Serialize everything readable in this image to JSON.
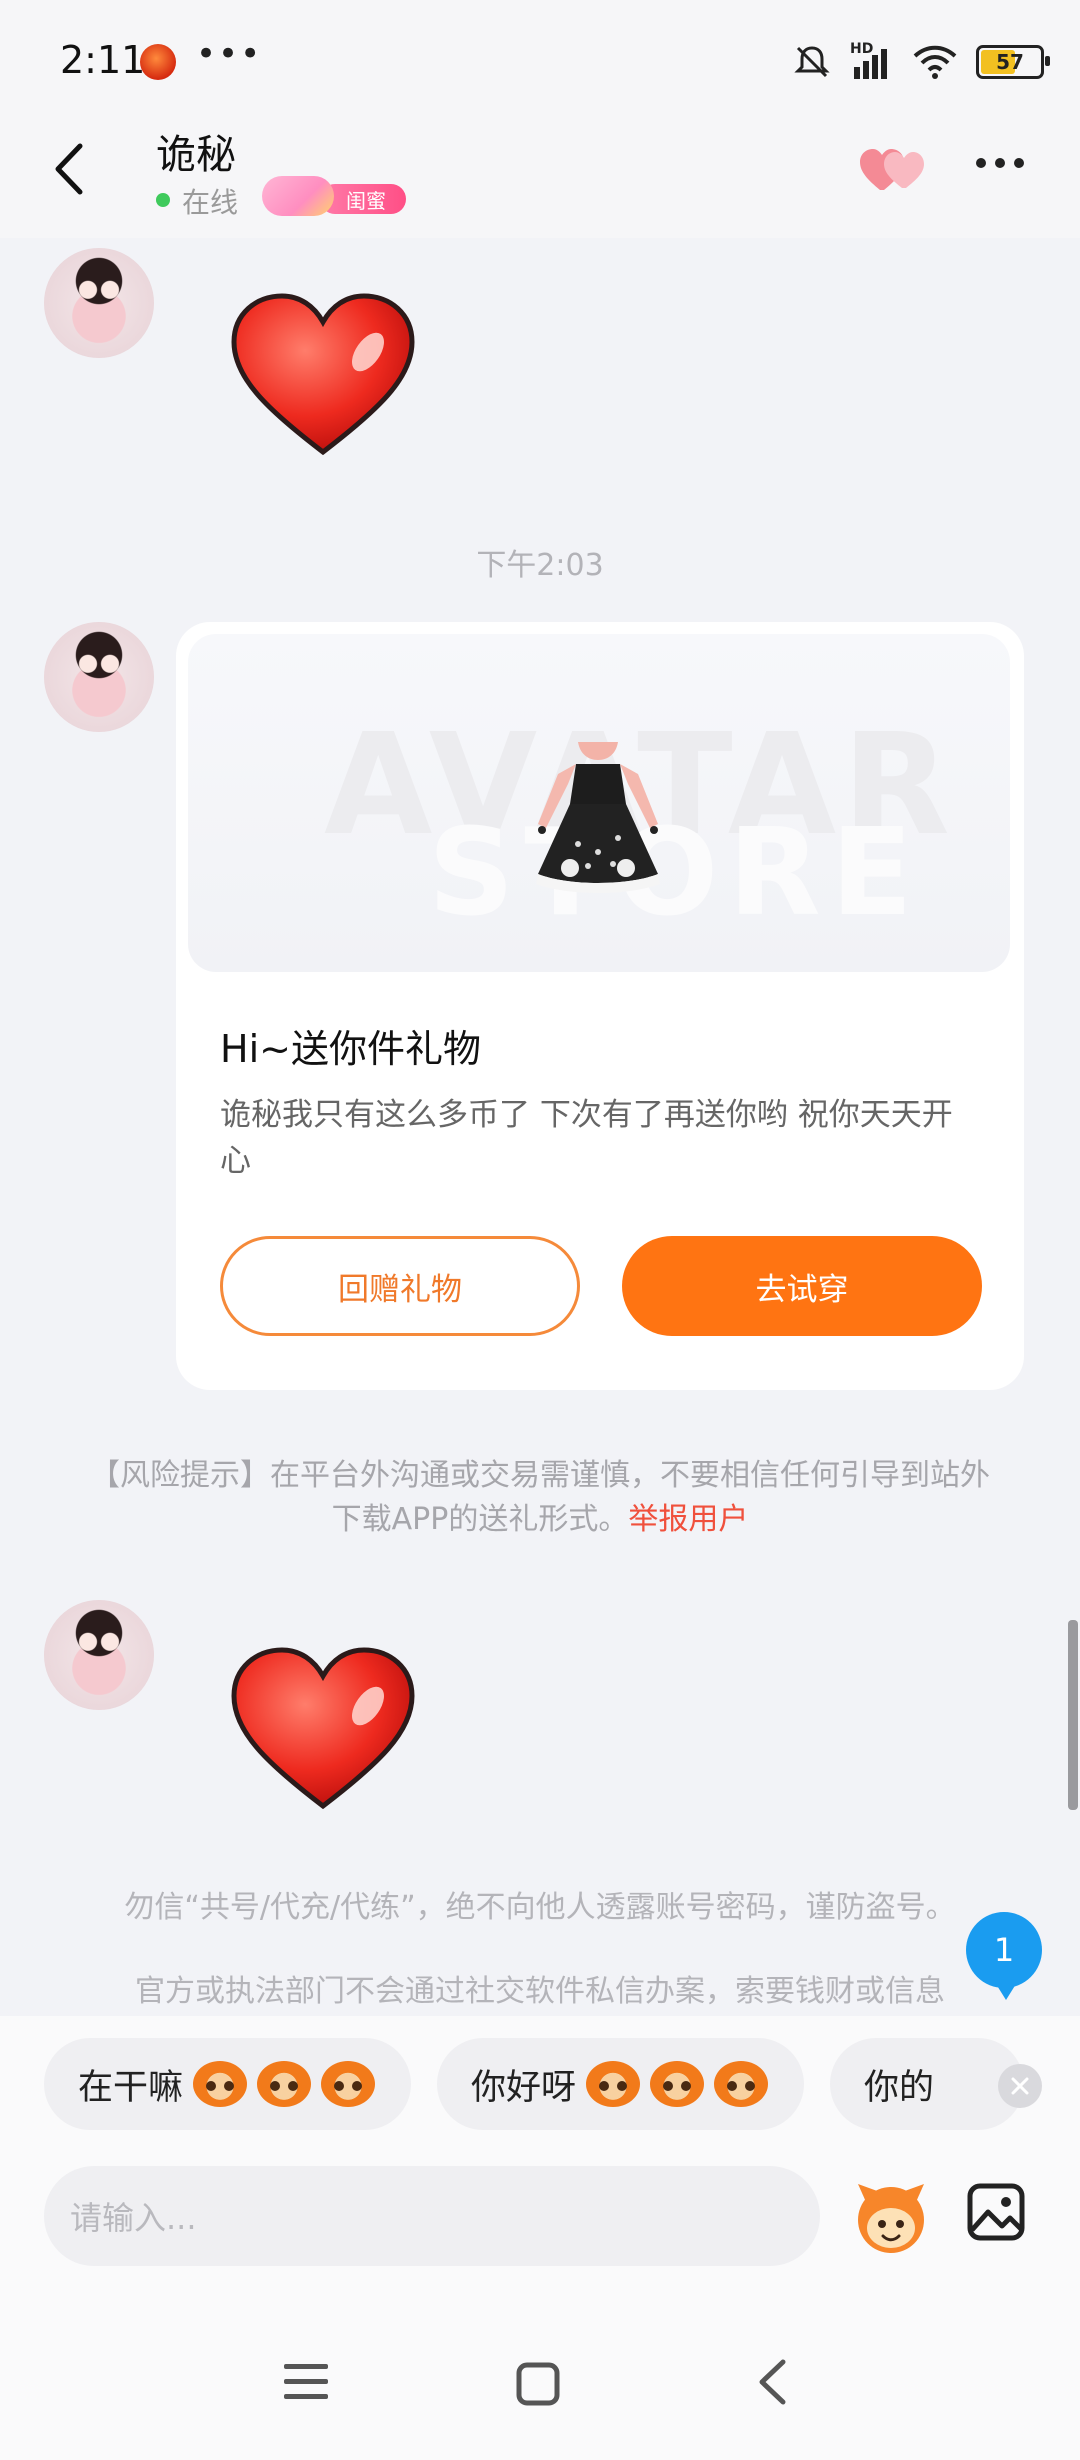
{
  "status_bar": {
    "time": "2:11",
    "overflow": "•••",
    "battery": "57",
    "signal_label": "HD"
  },
  "header": {
    "name": "诡秘",
    "status": "在线",
    "badge": "闺蜜"
  },
  "messages": {
    "timestamp": "下午2:03",
    "gift_card": {
      "watermark_top": "AVATAR",
      "watermark_bottom": "STORE",
      "title": "Hi~送你件礼物",
      "body": "诡秘我只有这么多币了 下次有了再送你哟 祝你天天开心",
      "button_return": "回赠礼物",
      "button_try": "去试穿"
    },
    "risk_notice": "【风险提示】在平台外沟通或交易需谨慎，不要相信任何引导到站外下载APP的送礼形式。",
    "risk_link": "举报用户",
    "notice_1": "勿信“共号/代充/代练”，绝不向他人透露账号密码，谨防盗号。",
    "notice_2": "官方或执法部门不会通过社交软件私信办案，索要钱财或信息",
    "unread_count": "1"
  },
  "quick_replies": [
    {
      "label": "在干嘛"
    },
    {
      "label": "你好呀"
    },
    {
      "label": "你的"
    }
  ],
  "composer": {
    "placeholder": "请输入..."
  },
  "icons": [
    "back-icon",
    "hearts-icon",
    "more-icon",
    "heart-sticker",
    "close-icon",
    "emoji-icon",
    "image-icon",
    "menu-nav-icon",
    "home-nav-icon",
    "back-nav-icon"
  ],
  "colors": {
    "accent_orange": "#ff7412",
    "link_red": "#f0503c",
    "online_green": "#3fca5c",
    "unread_blue": "#1a9cf0"
  }
}
